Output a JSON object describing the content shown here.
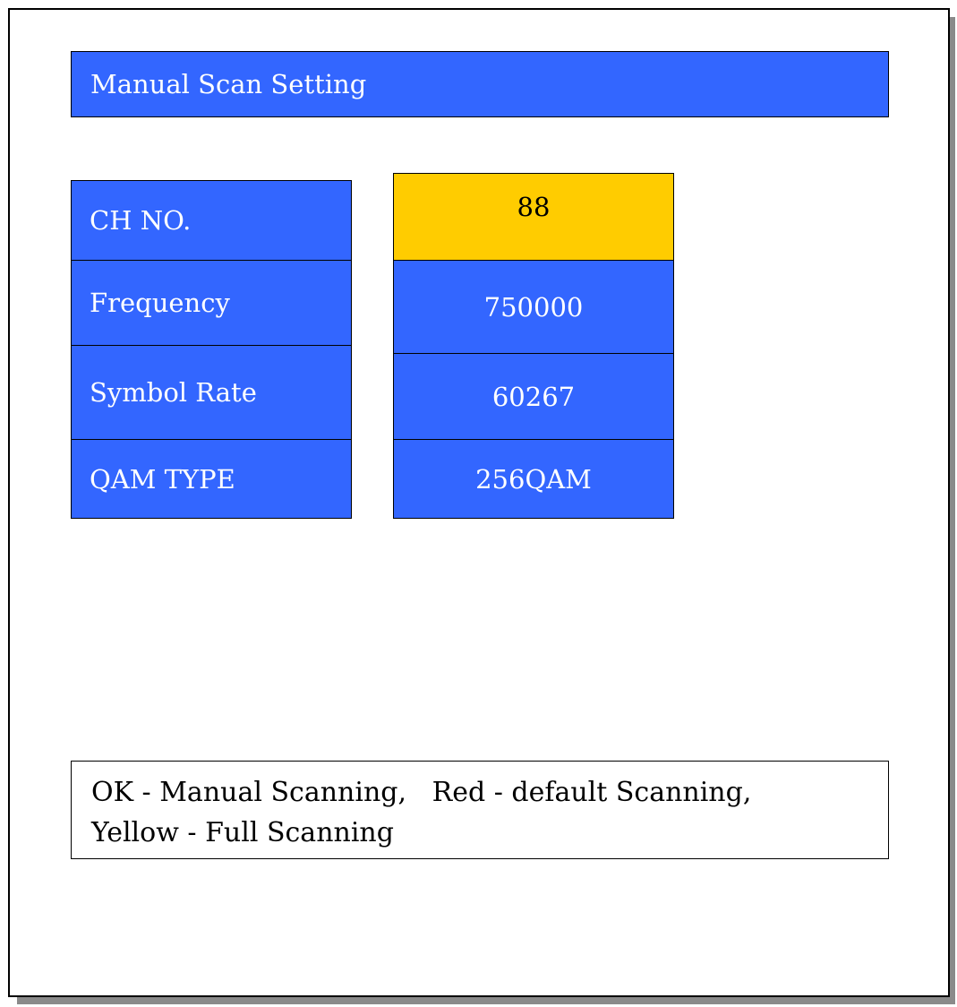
{
  "header": {
    "title": "Manual Scan Setting"
  },
  "settings": {
    "rows": [
      {
        "label": "CH NO.",
        "value": "88",
        "selected": true
      },
      {
        "label": "Frequency",
        "value": "750000",
        "selected": false
      },
      {
        "label": "Symbol Rate",
        "value": "60267",
        "selected": false
      },
      {
        "label": "QAM TYPE",
        "value": "256QAM",
        "selected": false
      }
    ]
  },
  "help": {
    "line1": "OK - Manual Scanning,   Red - default Scanning,",
    "line2": "Yellow - Full Scanning"
  },
  "colors": {
    "panel_blue": "#3366ff",
    "highlight_yellow": "#ffcc00",
    "frame_shadow": "#8a8a8a"
  }
}
